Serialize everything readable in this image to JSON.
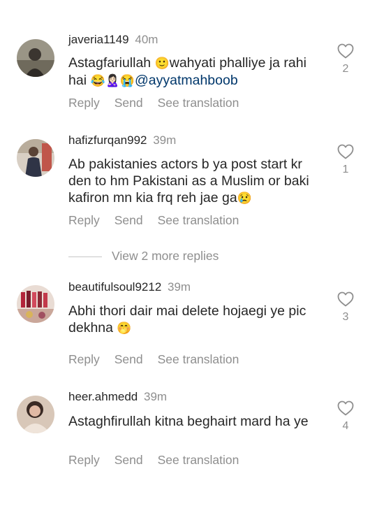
{
  "comments": [
    {
      "username": "javeria1149",
      "time": "40m",
      "text_parts": [
        "Astagfariullah ",
        "🙂",
        "wahyati  phalliye ja rahi hai ",
        "😂🙎🏻‍♀️😭",
        "@ayyatmahboob"
      ],
      "likes": "2",
      "reply_label": "Reply",
      "send_label": "Send",
      "translate_label": "See translation"
    },
    {
      "username": "hafizfurqan992",
      "time": "39m",
      "text_parts": [
        "Ab pakistanies actors b ya post start kr den to hm Pakistani as a Muslim or baki kafiron mn kia frq reh jae ga",
        "😢"
      ],
      "likes": "1",
      "reply_label": "Reply",
      "send_label": "Send",
      "translate_label": "See translation"
    },
    {
      "username": "beautifulsoul9212",
      "time": "39m",
      "text_parts": [
        "Abhi thori dair mai delete hojaegi ye pic dekhna ",
        "🤭"
      ],
      "likes": "3",
      "reply_label": "Reply",
      "send_label": "Send",
      "translate_label": "See translation"
    },
    {
      "username": "heer.ahmedd",
      "time": "39m",
      "text_parts": [
        "Astaghfirullah kitna beghairt mard ha ye"
      ],
      "likes": "4",
      "reply_label": "Reply",
      "send_label": "Send",
      "translate_label": "See translation"
    }
  ],
  "view_replies": "View 2 more replies",
  "colors": {
    "text": "#262626",
    "secondary": "#8e8e8e",
    "mention": "#00376b"
  },
  "icons": [
    "avatar-image",
    "heart-outline-icon"
  ]
}
